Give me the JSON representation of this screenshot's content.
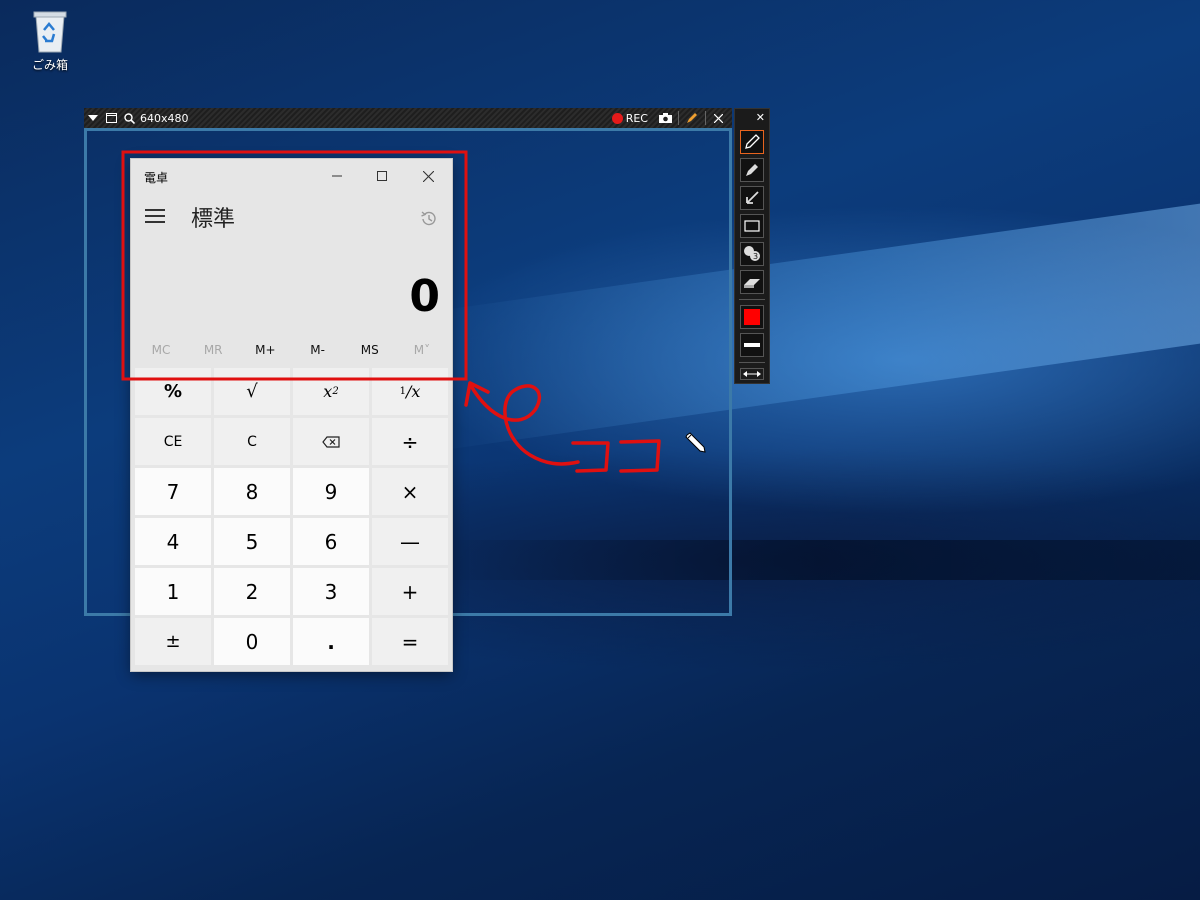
{
  "desktop": {
    "recycle_bin_label": "ごみ箱"
  },
  "capture_toolbar": {
    "size_label": "640x480",
    "rec_label": "REC",
    "icons": [
      "dropdown-icon",
      "window-icon",
      "magnifier-icon",
      "camera-icon",
      "pen-icon",
      "close-icon"
    ]
  },
  "pen_toolbar": {
    "tools": [
      "pencil-icon",
      "marker-icon",
      "arrow-icon",
      "rectangle-icon",
      "number-stamp-icon",
      "eraser-icon"
    ],
    "color": "#ff0000",
    "stroke": "thick-line"
  },
  "calculator": {
    "title": "電卓",
    "mode": "標準",
    "display": "0",
    "memory": [
      {
        "label": "MC",
        "enabled": false
      },
      {
        "label": "MR",
        "enabled": false
      },
      {
        "label": "M+",
        "enabled": true
      },
      {
        "label": "M-",
        "enabled": true
      },
      {
        "label": "MS",
        "enabled": true
      },
      {
        "label": "M˅",
        "enabled": false
      }
    ],
    "keys": {
      "percent": "%",
      "sqrt": "√",
      "square_base": "x",
      "square_exp": "2",
      "reciprocal_num": "1",
      "reciprocal_den": "x",
      "ce": "CE",
      "c": "C",
      "backspace": "⌫",
      "divide": "÷",
      "d7": "7",
      "d8": "8",
      "d9": "9",
      "multiply": "×",
      "d4": "4",
      "d5": "5",
      "d6": "6",
      "minus": "—",
      "d1": "1",
      "d2": "2",
      "d3": "3",
      "plus": "+",
      "negate": "±",
      "d0": "0",
      "dot": ".",
      "equals": "="
    }
  },
  "annotation": {
    "handwritten_text": "ココ",
    "color": "#e01010"
  }
}
